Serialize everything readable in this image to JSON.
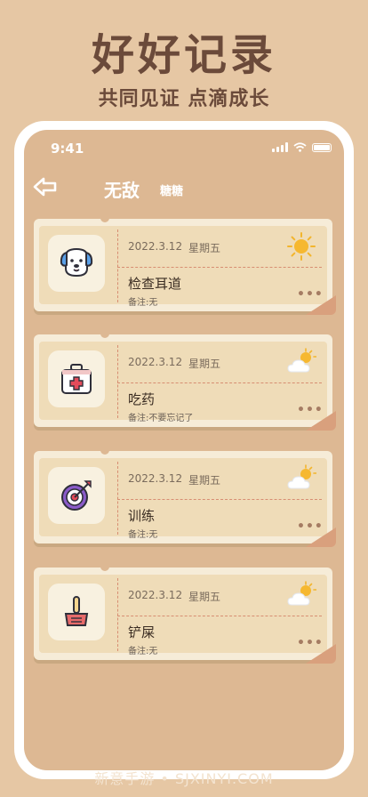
{
  "banner": {
    "title": "好好记录",
    "subtitle": "共同见证 点滴成长"
  },
  "status_bar": {
    "time": "9:41"
  },
  "nav": {
    "title": "无敌",
    "subtitle": "糖糖",
    "back_icon": "back-arrow-icon"
  },
  "records": [
    {
      "date": "2022.3.12",
      "weekday": "星期五",
      "title": "检查耳道",
      "note": "备注:无",
      "icon": "dog-icon",
      "weather": "sunny-icon"
    },
    {
      "date": "2022.3.12",
      "weekday": "星期五",
      "title": "吃药",
      "note": "备注:不要忘记了",
      "icon": "medical-kit-icon",
      "weather": "partly-cloudy-icon"
    },
    {
      "date": "2022.3.12",
      "weekday": "星期五",
      "title": "训练",
      "note": "备注:无",
      "icon": "target-icon",
      "weather": "partly-cloudy-icon"
    },
    {
      "date": "2022.3.12",
      "weekday": "星期五",
      "title": "铲屎",
      "note": "备注:无",
      "icon": "poop-scoop-icon",
      "weather": "partly-cloudy-icon"
    }
  ],
  "more_label": "•••",
  "watermark": "新意手游 • SJXINYI.COM",
  "colors": {
    "background": "#e6c7a4",
    "card": "#f6ecd8",
    "accent": "#d78e72",
    "heading": "#6b4a3a"
  }
}
